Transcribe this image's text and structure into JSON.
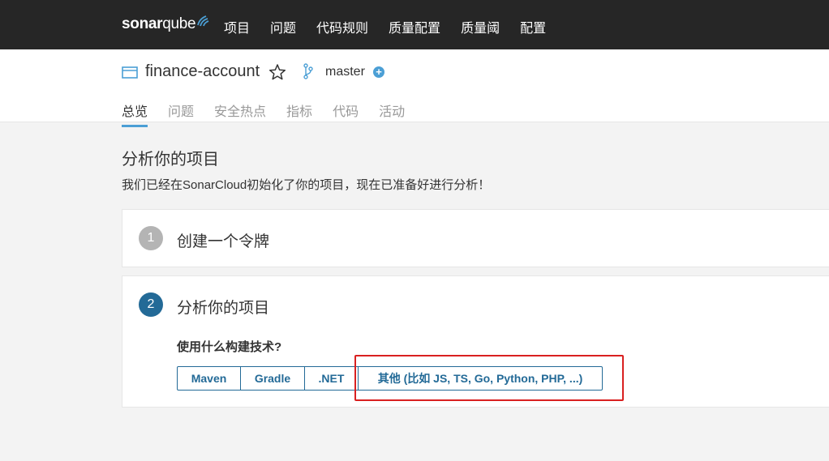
{
  "topbar": {
    "logo": {
      "part1": "sonar",
      "part2": "qube"
    },
    "nav": [
      "项目",
      "问题",
      "代码规则",
      "质量配置",
      "质量阈",
      "配置"
    ]
  },
  "project": {
    "name": "finance-account",
    "branch": "master",
    "branch_add": "+"
  },
  "tabs": [
    "总览",
    "问题",
    "安全热点",
    "指标",
    "代码",
    "活动"
  ],
  "page": {
    "title": "分析你的项目",
    "description": "我们已经在SonarCloud初始化了你的项目，现在已准备好进行分析！"
  },
  "steps": [
    {
      "number": "1",
      "title": "创建一个令牌"
    },
    {
      "number": "2",
      "title": "分析你的项目",
      "question": "使用什么构建技术?"
    }
  ],
  "build_options": [
    "Maven",
    "Gradle",
    ".NET",
    "其他 (比如 JS, TS, Go, Python, PHP, ...)"
  ],
  "colors": {
    "topbar": "#262626",
    "accent": "#4b9fd5",
    "primary": "#236a97",
    "highlight": "#d92020"
  }
}
